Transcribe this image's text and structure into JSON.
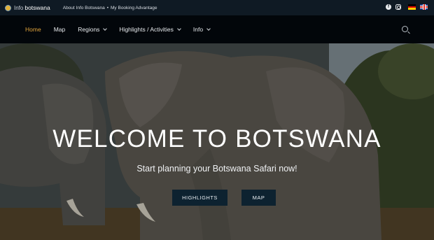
{
  "topbar": {
    "logo_prefix": "Info",
    "logo_name": "botswana",
    "links": [
      "About Info Botswana",
      "My Booking Advantage"
    ],
    "separator": "•",
    "social_icons": [
      "facebook-icon",
      "instagram-icon"
    ],
    "languages": [
      "de-flag-icon",
      "uk-flag-icon"
    ]
  },
  "nav": {
    "items": [
      {
        "label": "Home",
        "active": true,
        "dropdown": false
      },
      {
        "label": "Map",
        "active": false,
        "dropdown": false
      },
      {
        "label": "Regions",
        "active": false,
        "dropdown": true
      },
      {
        "label": "Highlights / Activities",
        "active": false,
        "dropdown": true
      },
      {
        "label": "Info",
        "active": false,
        "dropdown": true
      }
    ],
    "active_color": "#e0a43c"
  },
  "hero": {
    "title": "WELCOME TO BOTSWANA",
    "subtitle": "Start planning your Botswana Safari now!",
    "buttons": [
      "HIGHLIGHTS",
      "MAP"
    ],
    "button_color": "#0d2230"
  }
}
